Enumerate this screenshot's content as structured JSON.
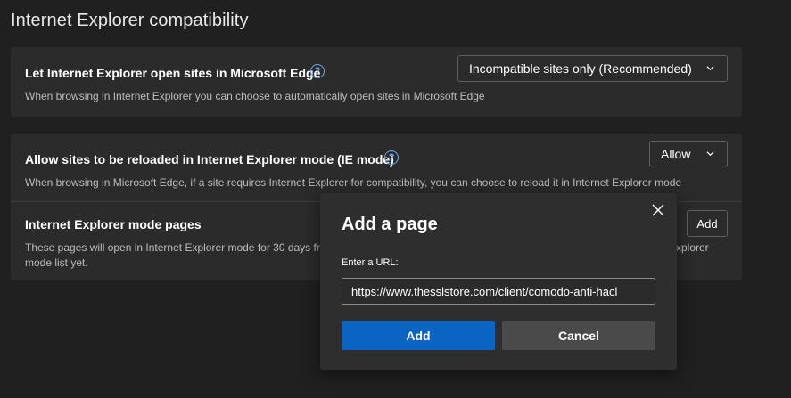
{
  "section": {
    "title": "Internet Explorer compatibility"
  },
  "ie_open_sites": {
    "title": "Let Internet Explorer open sites in Microsoft Edge",
    "description": "When browsing in Internet Explorer you can choose to automatically open sites in Microsoft Edge",
    "selected": "Incompatible sites only (Recommended)"
  },
  "ie_mode_reload": {
    "title": "Allow sites to be reloaded in Internet Explorer mode (IE mode)",
    "description": "When browsing in Microsoft Edge, if a site requires Internet Explorer for compatibility, you can choose to reload it in Internet Explorer mode",
    "selected": "Allow"
  },
  "ie_mode_pages": {
    "title": "Internet Explorer mode pages",
    "description_line1": "These pages will open in Internet Explorer mode for 30 days fro",
    "description_line1_tail": "xplorer",
    "description_line2": "mode list yet.",
    "add_label": "Add"
  },
  "dialog": {
    "title": "Add a page",
    "field_label": "Enter a URL:",
    "url_value": "https://www.thesslstore.com/client/comodo-anti-hacl",
    "add_label": "Add",
    "cancel_label": "Cancel"
  },
  "colors": {
    "accent": "#0a64c2",
    "help_icon": "#6aa8e8"
  }
}
